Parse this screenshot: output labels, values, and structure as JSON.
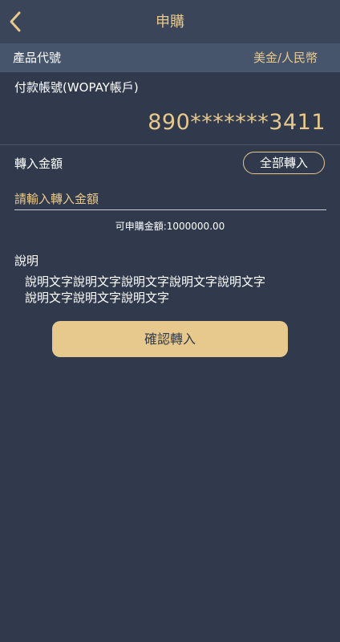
{
  "header": {
    "title": "申購",
    "back_icon": "chevron-left-icon"
  },
  "product": {
    "label": "產品代號",
    "value": "美金/人民幣"
  },
  "account": {
    "label": "付款帳號(WOPAY帳戶)",
    "number": "890*******3411"
  },
  "amount": {
    "label": "轉入金額",
    "transfer_all_label": "全部轉入",
    "input_placeholder": "請輸入轉入金額",
    "input_value": "",
    "available_text": "可申購金額:1000000.00"
  },
  "note": {
    "label": "說明",
    "lines": [
      "說明文字說明文字說明文字說明文字說明文字",
      "說明文字說明文字說明文字"
    ]
  },
  "confirm": {
    "label": "確認轉入"
  },
  "colors": {
    "background": "#303a4c",
    "nav_bar": "#3a455a",
    "product_bar": "#46546c",
    "accent_gold": "#e7c98e",
    "text_white": "#ffffff"
  }
}
